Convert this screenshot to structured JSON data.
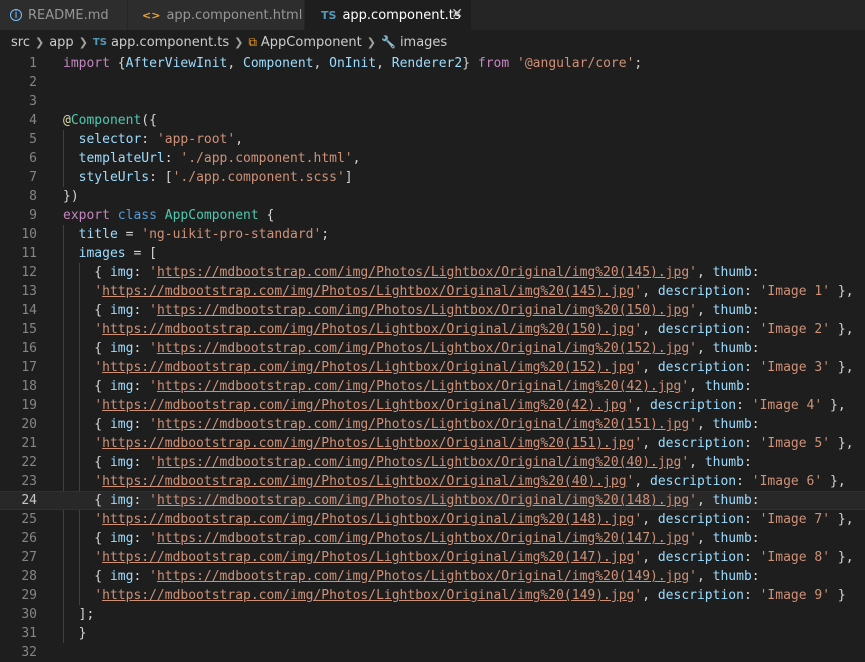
{
  "tabs": [
    {
      "label": "README.md",
      "icon": "info-icon",
      "active": false
    },
    {
      "label": "app.component.html",
      "icon": "angular-brackets-icon",
      "active": false
    },
    {
      "label": "app.component.ts",
      "icon": "typescript-icon",
      "active": true
    }
  ],
  "tab_ts_icon_text": "TS",
  "tab_ng_icon_text": "<>",
  "breadcrumb": [
    "src",
    "app",
    "app.component.ts",
    "AppComponent",
    "images"
  ],
  "breadcrumb_ts_icon_text": "TS",
  "code": {
    "line_numbers": [
      "1",
      "2",
      "3",
      "4",
      "5",
      "6",
      "7",
      "8",
      "9",
      "10",
      "11",
      "12",
      "13",
      "14",
      "15",
      "16",
      "17",
      "18",
      "19",
      "20",
      "21",
      "22",
      "23",
      "24",
      "25",
      "26",
      "27",
      "28",
      "29",
      "30",
      "31",
      "32"
    ],
    "current_line": 24,
    "import_kw": "import",
    "import_open": "{",
    "import_names": [
      "AfterViewInit",
      "Component",
      "OnInit",
      "Renderer2"
    ],
    "import_close": "}",
    "from_kw": "from",
    "import_module": "'@angular/core'",
    "decorator_at": "@",
    "decorator_name": "Component",
    "selector_key": "selector",
    "selector_value": "'app-root'",
    "templateUrl_key": "templateUrl",
    "templateUrl_value": "'./app.component.html'",
    "styleUrls_key": "styleUrls",
    "styleUrls_value": "'./app.component.scss'",
    "decorator_close": "})",
    "export_kw": "export",
    "class_kw": "class",
    "class_name": "AppComponent",
    "title_key": "title",
    "title_value": "'ng-uikit-pro-standard'",
    "images_key": "images",
    "array_close": "];",
    "class_close": "}",
    "images": [
      {
        "img": "https://mdbootstrap.com/img/Photos/Lightbox/Original/img%20(145).jpg",
        "thumb": "https://mdbootstrap.com/img/Photos/Lightbox/Original/img%20(145).jpg",
        "description": "'Image 1'",
        "end": " },"
      },
      {
        "img": "https://mdbootstrap.com/img/Photos/Lightbox/Original/img%20(150).jpg",
        "thumb": "https://mdbootstrap.com/img/Photos/Lightbox/Original/img%20(150).jpg",
        "description": "'Image 2'",
        "end": " },"
      },
      {
        "img": "https://mdbootstrap.com/img/Photos/Lightbox/Original/img%20(152).jpg",
        "thumb": "https://mdbootstrap.com/img/Photos/Lightbox/Original/img%20(152).jpg",
        "description": "'Image 3'",
        "end": " },"
      },
      {
        "img": "https://mdbootstrap.com/img/Photos/Lightbox/Original/img%20(42).jpg",
        "thumb": "https://mdbootstrap.com/img/Photos/Lightbox/Original/img%20(42).jpg",
        "description": "'Image 4'",
        "end": " },"
      },
      {
        "img": "https://mdbootstrap.com/img/Photos/Lightbox/Original/img%20(151).jpg",
        "thumb": "https://mdbootstrap.com/img/Photos/Lightbox/Original/img%20(151).jpg",
        "description": "'Image 5'",
        "end": " },"
      },
      {
        "img": "https://mdbootstrap.com/img/Photos/Lightbox/Original/img%20(40).jpg",
        "thumb": "https://mdbootstrap.com/img/Photos/Lightbox/Original/img%20(40).jpg",
        "description": "'Image 6'",
        "end": " },"
      },
      {
        "img": "https://mdbootstrap.com/img/Photos/Lightbox/Original/img%20(148).jpg",
        "thumb": "https://mdbootstrap.com/img/Photos/Lightbox/Original/img%20(148).jpg",
        "description": "'Image 7'",
        "end": " },"
      },
      {
        "img": "https://mdbootstrap.com/img/Photos/Lightbox/Original/img%20(147).jpg",
        "thumb": "https://mdbootstrap.com/img/Photos/Lightbox/Original/img%20(147).jpg",
        "description": "'Image 8'",
        "end": " },"
      },
      {
        "img": "https://mdbootstrap.com/img/Photos/Lightbox/Original/img%20(149).jpg",
        "thumb": "https://mdbootstrap.com/img/Photos/Lightbox/Original/img%20(149).jpg",
        "description": "'Image 9'",
        "end": " }"
      }
    ]
  },
  "colors": {
    "editor_bg": "#1e1e1e",
    "tab_inactive_bg": "#2d2d2d",
    "keyword": "#569cd6",
    "control_keyword": "#c586c0",
    "string": "#ce9178",
    "property": "#9cdcfe",
    "class": "#4ec9b0",
    "decorator": "#dcdcaa"
  }
}
